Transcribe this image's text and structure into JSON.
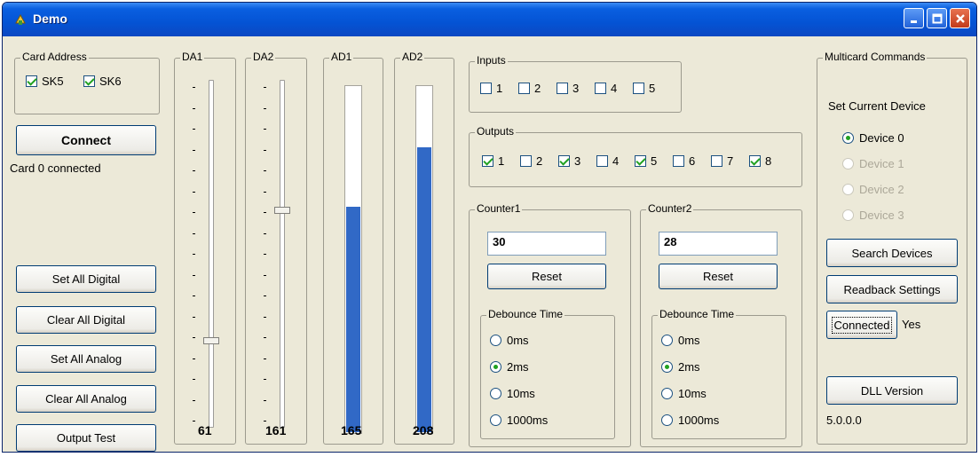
{
  "window": {
    "title": "Demo"
  },
  "card_address": {
    "label": "Card Address",
    "sk5": {
      "label": "SK5",
      "checked": true
    },
    "sk6": {
      "label": "SK6",
      "checked": true
    }
  },
  "connect_button": "Connect",
  "connection_status": "Card 0 connected",
  "left_buttons": {
    "set_all_digital": "Set All Digital",
    "clear_all_digital": "Clear All Digital",
    "set_all_analog": "Set All Analog",
    "clear_all_analog": "Clear All Analog",
    "output_test": "Output Test"
  },
  "da1": {
    "label": "DA1",
    "value": "61",
    "level_fraction": 0.24
  },
  "da2": {
    "label": "DA2",
    "value": "161",
    "level_fraction": 0.63
  },
  "ad1": {
    "label": "AD1",
    "value": "165",
    "fill_fraction": 0.65
  },
  "ad2": {
    "label": "AD2",
    "value": "208",
    "fill_fraction": 0.82
  },
  "inputs": {
    "label": "Inputs",
    "items": [
      {
        "label": "1",
        "checked": false
      },
      {
        "label": "2",
        "checked": false
      },
      {
        "label": "3",
        "checked": false
      },
      {
        "label": "4",
        "checked": false
      },
      {
        "label": "5",
        "checked": false
      }
    ]
  },
  "outputs": {
    "label": "Outputs",
    "items": [
      {
        "label": "1",
        "checked": true
      },
      {
        "label": "2",
        "checked": false
      },
      {
        "label": "3",
        "checked": true
      },
      {
        "label": "4",
        "checked": false
      },
      {
        "label": "5",
        "checked": true
      },
      {
        "label": "6",
        "checked": false
      },
      {
        "label": "7",
        "checked": false
      },
      {
        "label": "8",
        "checked": true
      }
    ]
  },
  "counter1": {
    "label": "Counter1",
    "value": "30",
    "reset": "Reset",
    "debounce_label": "Debounce Time",
    "options": [
      "0ms",
      "2ms",
      "10ms",
      "1000ms"
    ],
    "selected": "2ms"
  },
  "counter2": {
    "label": "Counter2",
    "value": "28",
    "reset": "Reset",
    "debounce_label": "Debounce Time",
    "options": [
      "0ms",
      "2ms",
      "10ms",
      "1000ms"
    ],
    "selected": "2ms"
  },
  "multicard": {
    "label": "Multicard Commands",
    "set_device_label": "Set Current Device",
    "devices": [
      {
        "label": "Device 0",
        "selected": true,
        "enabled": true
      },
      {
        "label": "Device 1",
        "selected": false,
        "enabled": false
      },
      {
        "label": "Device 2",
        "selected": false,
        "enabled": false
      },
      {
        "label": "Device 3",
        "selected": false,
        "enabled": false
      }
    ],
    "search_devices": "Search Devices",
    "readback_settings": "Readback Settings",
    "connected_button": "Connected",
    "connected_value": "Yes",
    "dll_version_button": "DLL Version",
    "dll_version_value": "5.0.0.0"
  }
}
